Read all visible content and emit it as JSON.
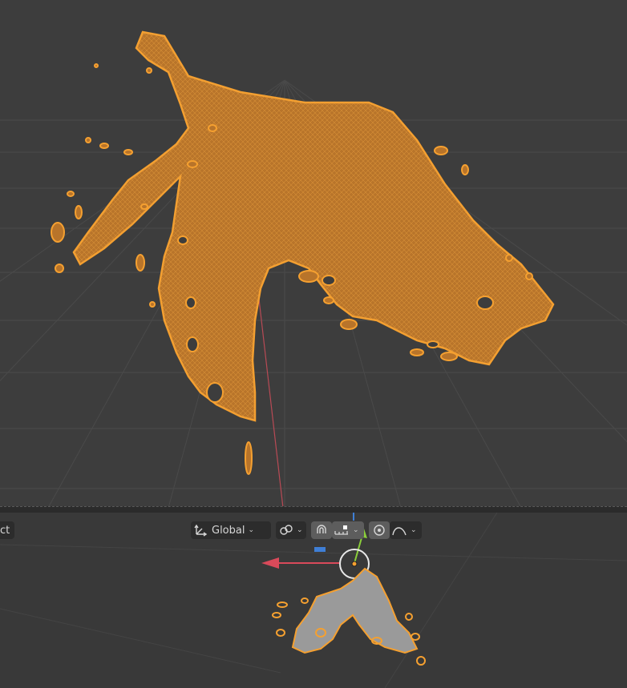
{
  "header": {
    "select_label": "ct",
    "orientation": {
      "icon": "transform-orientation-icon",
      "label": "Global"
    },
    "pivot_icon": "pivot-link-icon",
    "snap_icon": "magnet-icon",
    "snap_target_icon": "snap-increment-icon",
    "proportional_icon": "proportional-edit-icon",
    "falloff_icon": "falloff-curve-icon"
  },
  "colors": {
    "selection_orange": "#f5a030",
    "mesh_fill": "#b8742a",
    "grid_line": "#4a4a4a",
    "x_axis": "#d94a5a",
    "y_axis": "#8bcf3a",
    "z_axis": "#3f7fd6",
    "viewport_bg": "#3d3d3d"
  },
  "scene": {
    "object": "splash-mesh",
    "top_view_mode": "wireframe-overlay",
    "bottom_view_mode": "solid"
  }
}
